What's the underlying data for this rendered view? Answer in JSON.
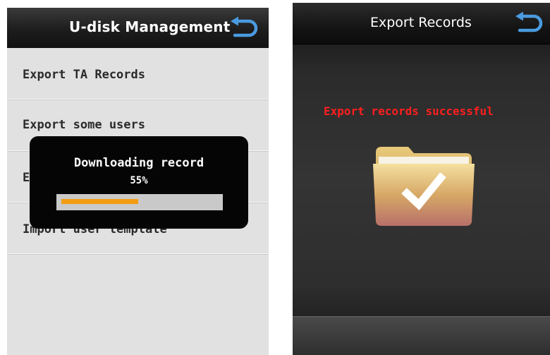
{
  "left_screen": {
    "title": "U-disk Management",
    "menu": [
      {
        "label": "Export TA Records"
      },
      {
        "label": "Export some users"
      },
      {
        "label": "E"
      },
      {
        "label": "Import user template"
      }
    ],
    "dialog": {
      "message": "Downloading record",
      "percent_label": "55%",
      "progress": 0.55,
      "progress_color": "#f39c12"
    },
    "back_icon": "back-arrow-icon"
  },
  "right_screen": {
    "title": "Export Records",
    "message": "Export records successful",
    "message_color": "#ff1e1e",
    "icon": "folder-check-icon",
    "back_icon": "back-arrow-icon"
  }
}
